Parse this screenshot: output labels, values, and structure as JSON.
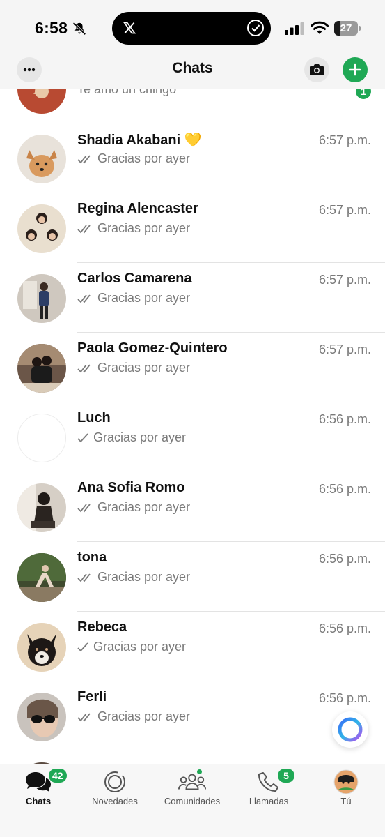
{
  "status": {
    "time": "6:58",
    "battery": "27"
  },
  "header": {
    "title": "Chats"
  },
  "chats": [
    {
      "name": "",
      "preview": "Te amo un chingo",
      "time": "",
      "ticks": "none",
      "unread": "1"
    },
    {
      "name": "Shadia Akabani 💛",
      "preview": "Gracias por ayer",
      "time": "6:57 p.m.",
      "ticks": "double"
    },
    {
      "name": "Regina Alencaster",
      "preview": "Gracias por ayer",
      "time": "6:57 p.m.",
      "ticks": "double"
    },
    {
      "name": "Carlos Camarena",
      "preview": "Gracias por ayer",
      "time": "6:57 p.m.",
      "ticks": "double"
    },
    {
      "name": "Paola Gomez-Quintero",
      "preview": "Gracias por ayer",
      "time": "6:57 p.m.",
      "ticks": "double"
    },
    {
      "name": "Luch",
      "preview": "Gracias por ayer",
      "time": "6:56 p.m.",
      "ticks": "single"
    },
    {
      "name": "Ana Sofia Romo",
      "preview": "Gracias por ayer",
      "time": "6:56 p.m.",
      "ticks": "double"
    },
    {
      "name": "tona",
      "preview": "Gracias por ayer",
      "time": "6:56 p.m.",
      "ticks": "double"
    },
    {
      "name": "Rebeca",
      "preview": "Gracias por ayer",
      "time": "6:56 p.m.",
      "ticks": "single"
    },
    {
      "name": "Ferli",
      "preview": "Gracias por ayer",
      "time": "6:56 p.m.",
      "ticks": "double"
    }
  ],
  "tabs": [
    {
      "label": "Chats",
      "icon": "chats-icon",
      "badge": "42",
      "active": true
    },
    {
      "label": "Novedades",
      "icon": "updates-icon"
    },
    {
      "label": "Comunidades",
      "icon": "communities-icon"
    },
    {
      "label": "Llamadas",
      "icon": "calls-icon",
      "badge": "5"
    },
    {
      "label": "Tú",
      "icon": "profile-avatar"
    }
  ],
  "colors": {
    "accent": "#1fa855",
    "muted_text": "#7a7a7a"
  }
}
